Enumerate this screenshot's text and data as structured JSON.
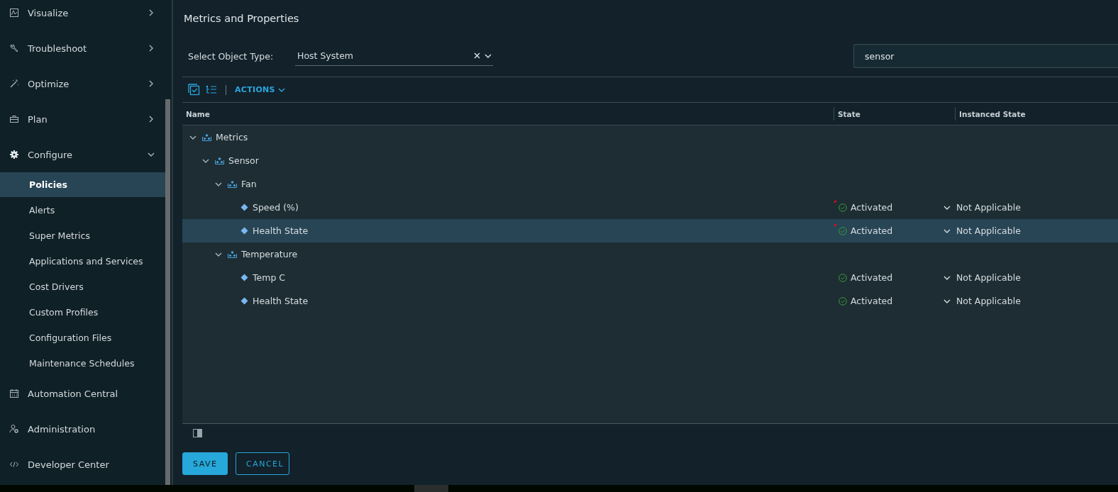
{
  "sidebar": {
    "items": [
      {
        "label": "Visualize",
        "kind": "section",
        "expanded": false
      },
      {
        "label": "Troubleshoot",
        "kind": "section",
        "expanded": false
      },
      {
        "label": "Optimize",
        "kind": "section",
        "expanded": false
      },
      {
        "label": "Plan",
        "kind": "section",
        "expanded": false
      },
      {
        "label": "Configure",
        "kind": "section",
        "expanded": true,
        "children": [
          {
            "label": "Policies",
            "selected": true
          },
          {
            "label": "Alerts",
            "selected": false
          },
          {
            "label": "Super Metrics",
            "selected": false
          },
          {
            "label": "Applications and Services",
            "selected": false
          },
          {
            "label": "Cost Drivers",
            "selected": false
          },
          {
            "label": "Custom Profiles",
            "selected": false
          },
          {
            "label": "Configuration Files",
            "selected": false
          },
          {
            "label": "Maintenance Schedules",
            "selected": false
          }
        ]
      },
      {
        "label": "Automation Central",
        "kind": "link"
      },
      {
        "label": "Administration",
        "kind": "link"
      },
      {
        "label": "Developer Center",
        "kind": "link"
      }
    ]
  },
  "page": {
    "title": "Metrics and Properties",
    "object_type": {
      "label": "Select Object Type:",
      "value": "Host System"
    },
    "search": {
      "value": "sensor"
    },
    "toolbar": {
      "actions": "ACTIONS"
    },
    "tree_grid": {
      "columns": [
        "Name",
        "State",
        "Instanced State"
      ],
      "rows": [
        {
          "name": "Metrics",
          "kind": "group",
          "expanded": true,
          "children": [
            {
              "name": "Sensor",
              "kind": "group",
              "expanded": true,
              "children": [
                {
                  "name": "Fan",
                  "kind": "group",
                  "expanded": true,
                  "children": [
                    {
                      "name": "Speed (%)",
                      "kind": "metric",
                      "selected": false,
                      "modified": true,
                      "state": "Activated",
                      "instanced_state": "Not Applicable"
                    },
                    {
                      "name": "Health State",
                      "kind": "metric",
                      "selected": true,
                      "modified": true,
                      "state": "Activated",
                      "instanced_state": "Not Applicable"
                    }
                  ]
                },
                {
                  "name": "Temperature",
                  "kind": "group",
                  "expanded": true,
                  "children": [
                    {
                      "name": "Temp C",
                      "kind": "metric",
                      "selected": false,
                      "modified": false,
                      "state": "Activated",
                      "instanced_state": "Not Applicable"
                    },
                    {
                      "name": "Health State",
                      "kind": "metric",
                      "selected": false,
                      "modified": false,
                      "state": "Activated",
                      "instanced_state": "Not Applicable"
                    }
                  ]
                }
              ]
            }
          ]
        }
      ]
    },
    "buttons": [
      {
        "label": "SAVE",
        "kind": "primary"
      },
      {
        "label": "CANCEL",
        "kind": "outline"
      }
    ]
  }
}
